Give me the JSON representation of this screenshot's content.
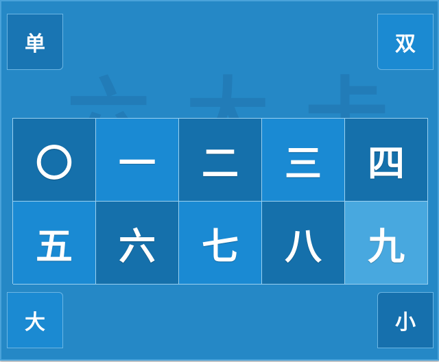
{
  "corners": {
    "top_left": "单",
    "top_right": "双",
    "bottom_left": "大",
    "bottom_right": "小"
  },
  "watermark": "六 大 卡",
  "grid": {
    "cells": [
      "〇",
      "一",
      "二",
      "三",
      "四",
      "五",
      "六",
      "七",
      "八",
      "九"
    ]
  }
}
